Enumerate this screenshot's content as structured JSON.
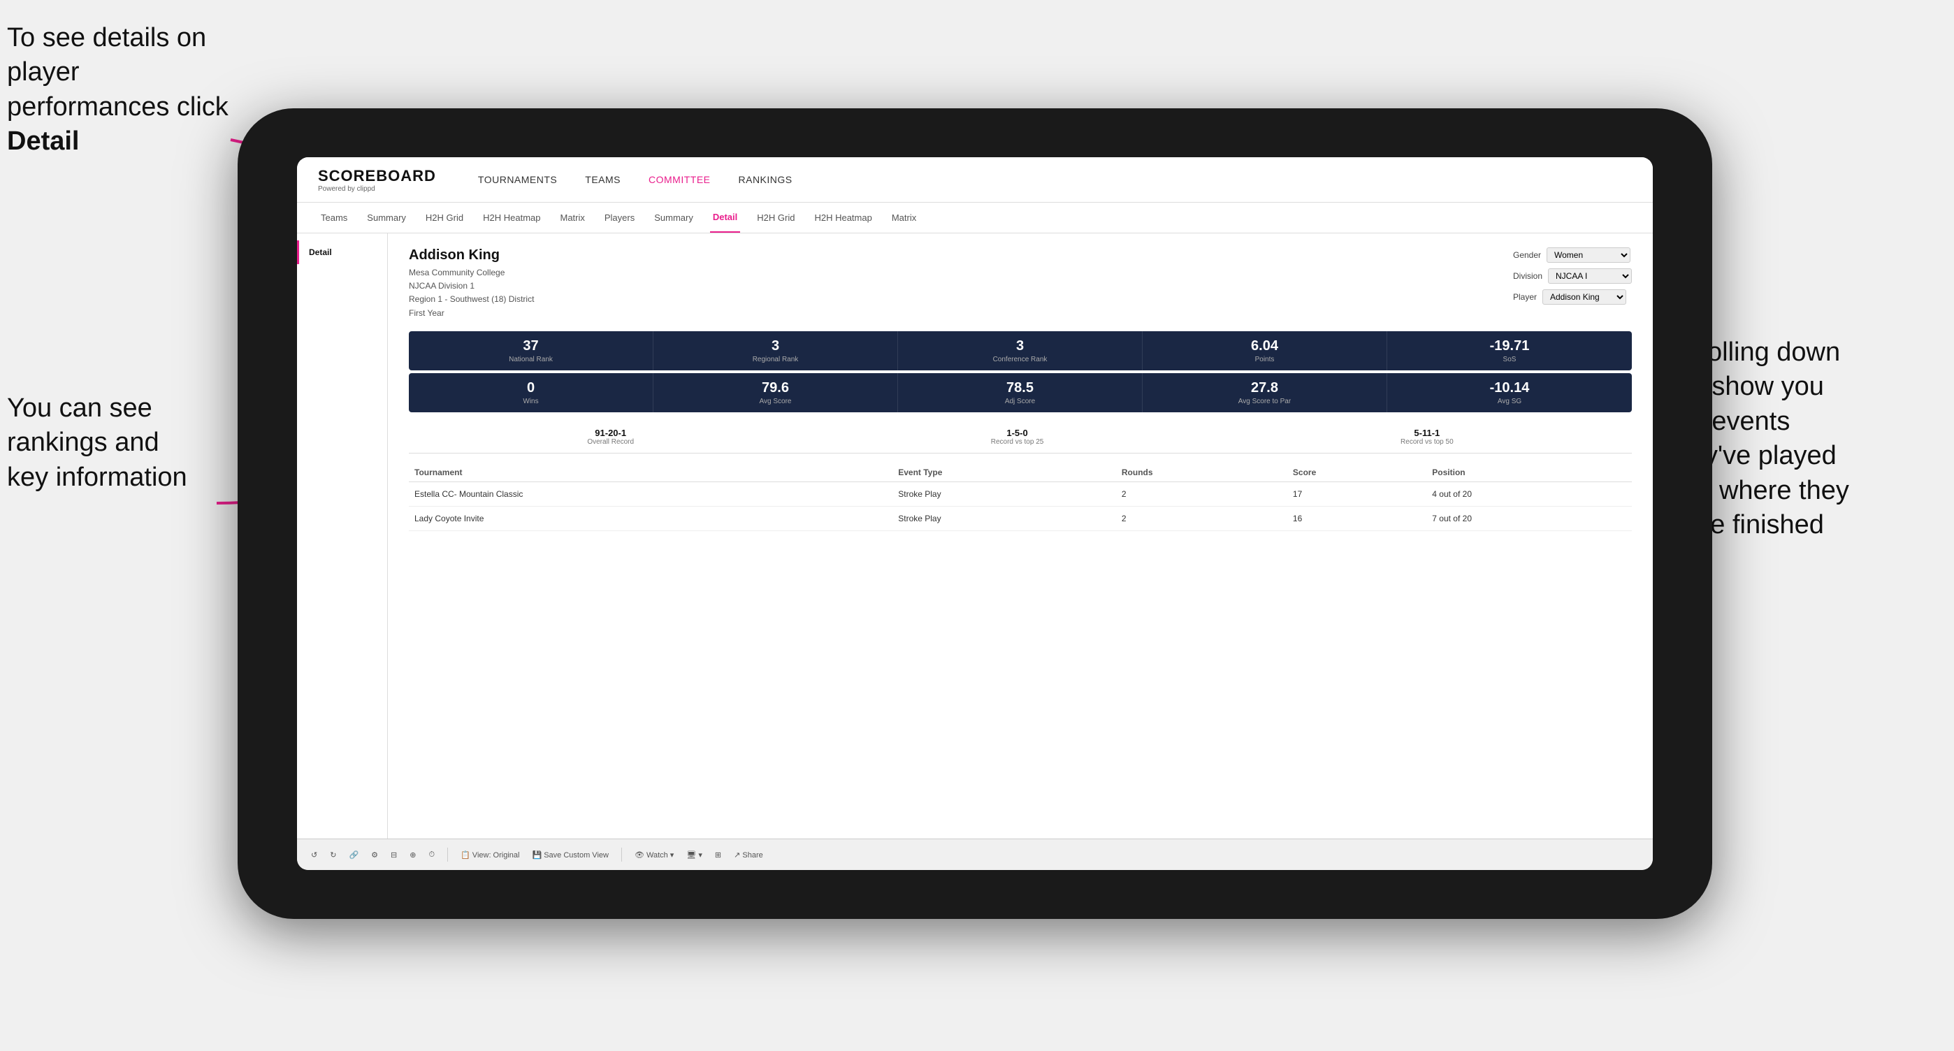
{
  "annotations": {
    "top_left": "To see details on player performances click ",
    "top_left_bold": "Detail",
    "bottom_left_line1": "You can see",
    "bottom_left_line2": "rankings and",
    "bottom_left_line3": "key information",
    "right_line1": "Scrolling down",
    "right_line2": "will show you",
    "right_line3": "the events",
    "right_line4": "they've played",
    "right_line5": "and where they",
    "right_line6": "have finished"
  },
  "header": {
    "logo": "SCOREBOARD",
    "logo_sub": "Powered by clippd",
    "nav_items": [
      "TOURNAMENTS",
      "TEAMS",
      "COMMITTEE",
      "RANKINGS"
    ]
  },
  "sub_nav": {
    "items": [
      "Teams",
      "Summary",
      "H2H Grid",
      "H2H Heatmap",
      "Matrix",
      "Players",
      "Summary",
      "Detail",
      "H2H Grid",
      "H2H Heatmap",
      "Matrix"
    ],
    "active": "Detail"
  },
  "player": {
    "name": "Addison King",
    "college": "Mesa Community College",
    "division": "NJCAA Division 1",
    "region": "Region 1 - Southwest (18) District",
    "year": "First Year",
    "gender_label": "Gender",
    "gender_value": "Women",
    "division_label": "Division",
    "division_value": "NJCAA I",
    "player_label": "Player",
    "player_value": "Addison King"
  },
  "stats_row1": [
    {
      "value": "37",
      "label": "National Rank"
    },
    {
      "value": "3",
      "label": "Regional Rank"
    },
    {
      "value": "3",
      "label": "Conference Rank"
    },
    {
      "value": "6.04",
      "label": "Points"
    },
    {
      "value": "-19.71",
      "label": "SoS"
    }
  ],
  "stats_row2": [
    {
      "value": "0",
      "label": "Wins"
    },
    {
      "value": "79.6",
      "label": "Avg Score"
    },
    {
      "value": "78.5",
      "label": "Adj Score"
    },
    {
      "value": "27.8",
      "label": "Avg Score to Par"
    },
    {
      "value": "-10.14",
      "label": "Avg SG"
    }
  ],
  "records": [
    {
      "value": "91-20-1",
      "label": "Overall Record"
    },
    {
      "value": "1-5-0",
      "label": "Record vs top 25"
    },
    {
      "value": "5-11-1",
      "label": "Record vs top 50"
    }
  ],
  "table": {
    "headers": [
      "Tournament",
      "Event Type",
      "Rounds",
      "Score",
      "Position"
    ],
    "rows": [
      {
        "tournament": "Estella CC- Mountain Classic",
        "event_type": "Stroke Play",
        "rounds": "2",
        "score": "17",
        "position": "4 out of 20"
      },
      {
        "tournament": "Lady Coyote Invite",
        "event_type": "Stroke Play",
        "rounds": "2",
        "score": "16",
        "position": "7 out of 20"
      }
    ]
  },
  "toolbar": {
    "buttons": [
      "↺",
      "↻",
      "🔗",
      "⚙",
      "⊟",
      "⊕",
      "⏱",
      "View: Original",
      "Save Custom View",
      "Watch ▾",
      "🖥 ▾",
      "⊞",
      "Share"
    ]
  },
  "colors": {
    "accent": "#e91e8c",
    "dark_bg": "#1a2744",
    "active_tab": "#e91e8c"
  }
}
